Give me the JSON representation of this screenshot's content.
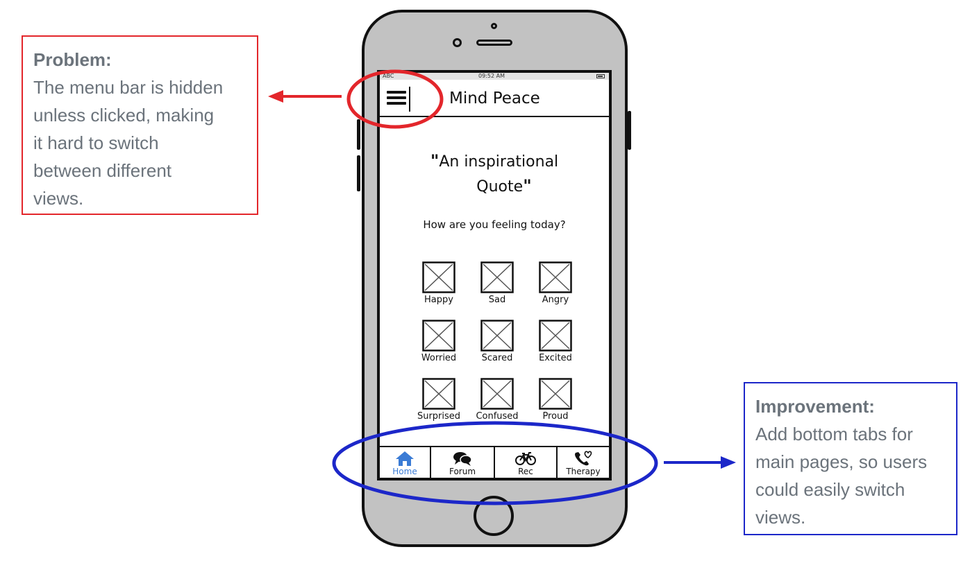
{
  "problem": {
    "heading": "Problem:",
    "lines": [
      "The menu bar is hidden",
      "unless clicked, making",
      "it hard to switch",
      "between different",
      "views."
    ]
  },
  "improvement": {
    "heading": "Improvement:",
    "lines": [
      "Add bottom tabs for",
      "main pages, so users",
      "could easily switch",
      "views."
    ]
  },
  "colors": {
    "problem": "#e3262b",
    "improvement": "#1c27c9",
    "text": "#6b737b",
    "phone_body": "#c2c2c2",
    "active_tab": "#3a7bd5"
  },
  "status_bar": {
    "carrier": "ABC",
    "time": "09:52 AM"
  },
  "app": {
    "title": "Mind Peace",
    "menu_icon": "hamburger-icon",
    "quote_line1": "An inspirational",
    "quote_line2": "Quote",
    "prompt": "How are you feeling today?"
  },
  "moods": [
    "Happy",
    "Sad",
    "Angry",
    "Worried",
    "Scared",
    "Excited",
    "Surprised",
    "Confused",
    "Proud"
  ],
  "tabs": [
    {
      "label": "Home",
      "icon": "home-icon",
      "active": true
    },
    {
      "label": "Forum",
      "icon": "chat-icon",
      "active": false
    },
    {
      "label": "Rec",
      "icon": "bicycle-icon",
      "active": false
    },
    {
      "label": "Therapy",
      "icon": "phone-heart-icon",
      "active": false
    }
  ]
}
